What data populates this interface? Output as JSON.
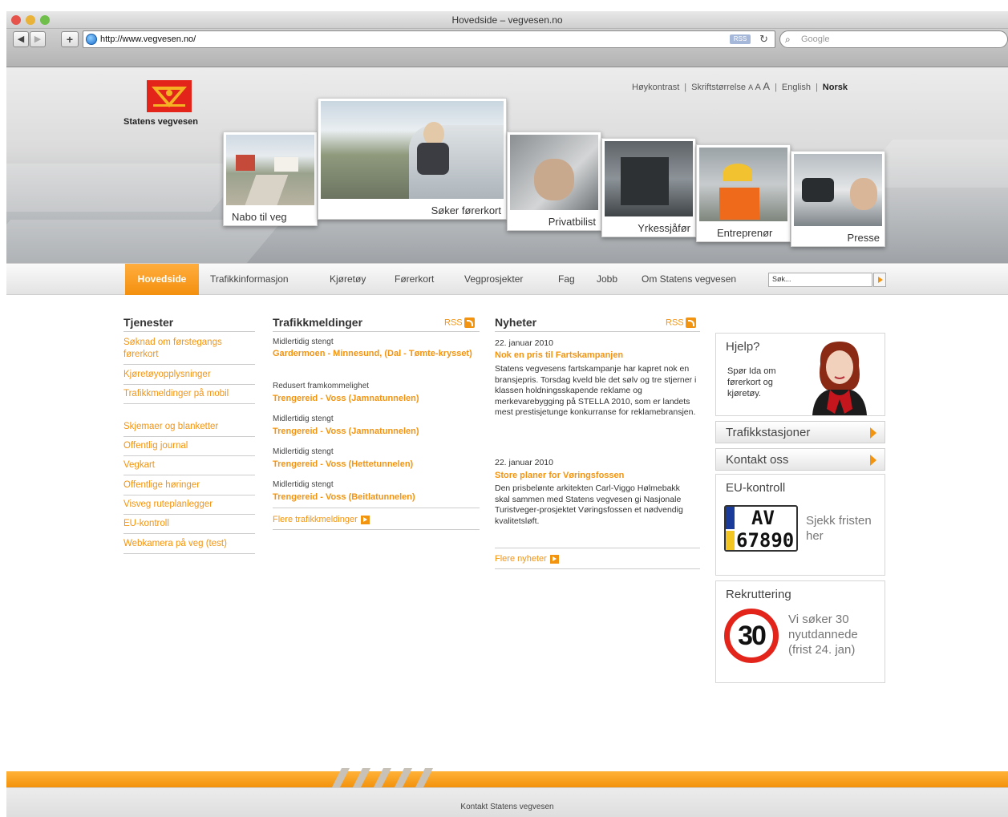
{
  "browser": {
    "window_title": "Hovedside – vegvesen.no",
    "url": "http://www.vegvesen.no/",
    "rss_badge": "RSS",
    "search_placeholder": "Google"
  },
  "site": {
    "logo_text": "Statens vegvesen",
    "toplinks": {
      "contrast": "Høykontrast",
      "fontsize": "Skriftstørrelse",
      "size_a1": "A",
      "size_a2": "A",
      "size_a3": "A",
      "english": "English",
      "norsk": "Norsk"
    },
    "hero": [
      "Nabo til veg",
      "Søker førerkort",
      "Privatbilist",
      "Yrkessjåfør",
      "Entreprenør",
      "Presse"
    ],
    "nav": [
      "Hovedside",
      "Trafikkinformasjon",
      "Kjøretøy",
      "Førerkort",
      "Vegprosjekter",
      "Fag",
      "Jobb",
      "Om Statens vegvesen"
    ],
    "nav_search": "Søk..."
  },
  "tjenester": {
    "heading": "Tjenester",
    "items": [
      "Søknad om førstegangs førerkort",
      "Kjøretøyopplysninger",
      "Trafikkmeldinger på mobil",
      "Skjemaer og blanketter",
      "Offentlig journal",
      "Vegkart",
      "Offentlige høringer",
      "Visveg ruteplanlegger",
      "EU-kontroll",
      "Webkamera på veg (test)"
    ]
  },
  "trafikk": {
    "heading": "Trafikkmeldinger",
    "rss": "RSS",
    "items": [
      {
        "status": "Midlertidig stengt",
        "link": "Gardermoen - Minnesund, (Dal - Tømte-krysset)"
      },
      {
        "status": "Redusert framkommelighet",
        "link": "Trengereid - Voss (Jamnatunnelen)"
      },
      {
        "status": "Midlertidig stengt",
        "link": "Trengereid - Voss (Jamnatunnelen)"
      },
      {
        "status": "Midlertidig stengt",
        "link": "Trengereid - Voss (Hettetunnelen)"
      },
      {
        "status": "Midlertidig stengt",
        "link": "Trengereid - Voss (Beitlatunnelen)"
      }
    ],
    "more": "Flere trafikkmeldinger"
  },
  "nyheter": {
    "heading": "Nyheter",
    "rss": "RSS",
    "items": [
      {
        "date": "22. januar 2010",
        "title": "Nok en pris til Fartskampanjen",
        "body": "Statens vegvesens fartskampanje har kapret nok en bransjepris. Torsdag kveld ble det sølv og tre stjerner i klassen holdningsskapende reklame og merkevarebygging på STELLA 2010, som er landets mest prestisjetunge konkurranse for reklamebransjen."
      },
      {
        "date": "22. januar 2010",
        "title": "Store planer for Vøringsfossen",
        "body": "Den prisbelønte arkitekten Carl-Viggo Hølmebakk skal sammen med Statens vegvesen gi Nasjonale Turistveger-prosjektet Vøringsfossen et nødvendig kvalitetsløft."
      }
    ],
    "more": "Flere nyheter"
  },
  "sidebar": {
    "hjelp": {
      "title": "Hjelp?",
      "text": "Spør Ida om førerkort og kjøretøy."
    },
    "trafikkstasjoner": "Trafikkstasjoner",
    "kontakt": "Kontakt oss",
    "eu": {
      "title": "EU-kontroll",
      "plate_top": "AV",
      "plate_bottom": "67890",
      "text": "Sjekk fristen her"
    },
    "rekruttering": {
      "title": "Rekruttering",
      "sign": "30",
      "text": "Vi søker 30 nyutdannede (frist 24. jan)"
    }
  },
  "footer": {
    "link": "Kontakt Statens vegvesen"
  },
  "colors": {
    "accent": "#f39411",
    "sign_red": "#e2241b"
  }
}
